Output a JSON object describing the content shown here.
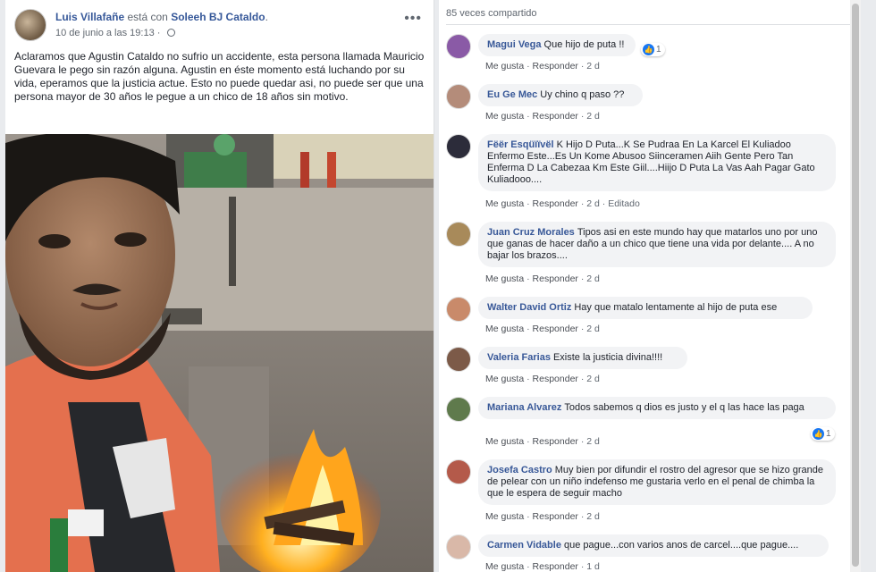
{
  "post": {
    "author": "Luis Villafañe",
    "with_text": "está con",
    "tagged": "Soleeh BJ Cataldo",
    "date": "10 de junio a las 19:13",
    "privacy_sep": "·",
    "more": "•••",
    "text": "Aclaramos que Agustin Cataldo no sufrio un accidente, esta persona llamada Mauricio Guevara le pego sin razón alguna. Agustin en éste momento está luchando por su vida, eperamos que la justicia actue. Esto no puede quedar asi, no puede ser que una persona mayor de 30 años le pegue a un chico de 18 años sin motivo."
  },
  "comments_panel": {
    "shares": "85 veces compartido",
    "like_label": "Me gusta",
    "reply_label": "Responder",
    "sep": "·",
    "comments": [
      {
        "author": "Magui Vega",
        "text": "Que hijo de puta !!",
        "time": "2 d",
        "reactions": "1",
        "edited": ""
      },
      {
        "author": "Eu Ge Mec",
        "text": "Uy chino q paso ??",
        "time": "2 d",
        "reactions": "",
        "edited": ""
      },
      {
        "author": "Fëër Esqüïïvël",
        "text": "K Hijo D Puta...K Se Pudraa En La Karcel El Kuliadoo Enfermo Este...Es Un Kome Abusoo Siinceramen Aiih Gente Pero Tan Enferma D La Cabezaa Km Este Giil....Hiijo D Puta La Vas Aah Pagar Gato Kuliadooo....",
        "time": "2 d",
        "reactions": "",
        "edited": "Editado"
      },
      {
        "author": "Juan Cruz Morales",
        "text": "Tipos asi en este mundo hay que matarlos uno por uno que ganas de hacer daño a un chico que tiene una vida por delante.... A no bajar los brazos....",
        "time": "2 d",
        "reactions": "",
        "edited": ""
      },
      {
        "author": "Walter David Ortiz",
        "text": "Hay que matalo lentamente al hijo de puta ese",
        "time": "2 d",
        "reactions": "",
        "edited": ""
      },
      {
        "author": "Valeria Farias",
        "text": "Existe la justicia divina!!!!",
        "time": "2 d",
        "reactions": "",
        "edited": ""
      },
      {
        "author": "Mariana Alvarez",
        "text": "Todos sabemos q dios es justo y el q las hace las paga",
        "time": "2 d",
        "reactions": "1",
        "edited": ""
      },
      {
        "author": "Josefa Castro",
        "text": "Muy bien por difundir el rostro del agresor que se hizo grande de pelear con un niño indefenso me gustaria verlo en el penal de chimba la que le espera de seguir macho",
        "time": "2 d",
        "reactions": "",
        "edited": ""
      },
      {
        "author": "Carmen Vidable",
        "text": "que pague...con varios anos de carcel....que pague....",
        "time": "1 d",
        "reactions": "",
        "edited": ""
      }
    ]
  }
}
